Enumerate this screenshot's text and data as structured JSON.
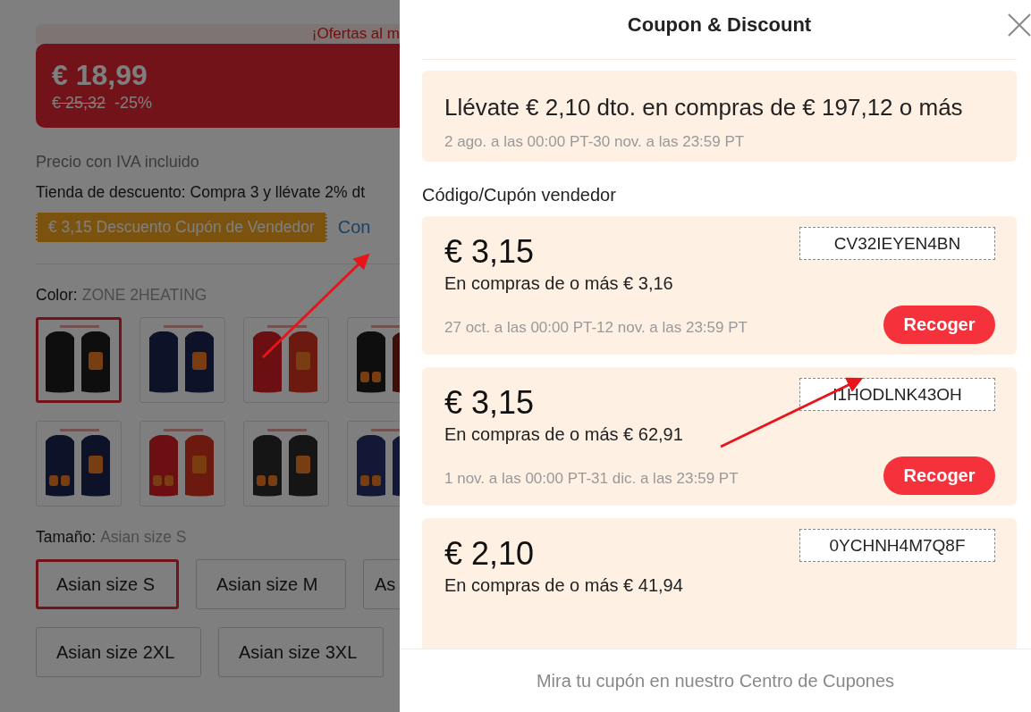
{
  "product": {
    "promo_banner": "¡Ofertas al m",
    "price": {
      "current": "€ 18,99",
      "original": "€ 25,32",
      "discount": "-25%"
    },
    "tax_note": "Precio con IVA incluido",
    "store_discount": "Tienda de descuento: Compra 3 y llévate 2% dt",
    "coupon_tag": "€ 3,15 Descuento Cupón de Vendedor",
    "coupon_link": "Con",
    "color": {
      "label": "Color:",
      "value": "ZONE 2HEATING"
    },
    "thumbnails": [
      {
        "kind": "picture",
        "selected": true
      },
      {
        "kind": "picture",
        "selected": false
      },
      {
        "kind": "picture",
        "selected": false
      },
      {
        "kind": "picture",
        "selected": false
      },
      {
        "kind": "picture",
        "selected": false
      },
      {
        "kind": "picture",
        "selected": false
      },
      {
        "kind": "picture",
        "selected": false
      },
      {
        "kind": "picture",
        "selected": false
      }
    ],
    "size": {
      "label": "Tamaño:",
      "value": "Asian size S"
    },
    "sizes": [
      {
        "label": "Asian size S",
        "selected": true
      },
      {
        "label": "Asian size M",
        "selected": false
      },
      {
        "label": "As",
        "selected": false
      },
      {
        "label": "Asian size 2XL",
        "selected": false
      },
      {
        "label": "Asian size 3XL",
        "selected": false
      }
    ]
  },
  "dialog": {
    "title": "Coupon & Discount",
    "store_offer": {
      "text": "Llévate € 2,10 dto. en compras de € 197,12 o más",
      "period": "2 ago. a las 00:00 PT-30 nov. a las 23:59 PT"
    },
    "section_title": "Código/Cupón vendedor",
    "coupons": [
      {
        "amount": "€ 3,15",
        "condition": "En compras de o más € 3,16",
        "code": "CV32IEYEN4BN",
        "period": "27 oct. a las 00:00 PT-12 nov. a las 23:59 PT",
        "button": "Recoger"
      },
      {
        "amount": "€ 3,15",
        "condition": "En compras de o más € 62,91",
        "code": "I1HODLNK43OH",
        "period": "1 nov. a las 00:00 PT-31 dic. a las 23:59 PT",
        "button": "Recoger"
      },
      {
        "amount": "€ 2,10",
        "condition": "En compras de o más € 41,94",
        "code": "0YCHNH4M7Q8F"
      }
    ],
    "footer": "Mira tu cupón en nuestro Centro de Cupones"
  }
}
